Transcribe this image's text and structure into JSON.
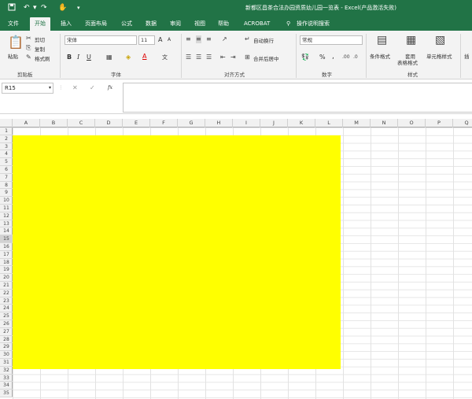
{
  "window": {
    "title": "新都区昌茶合法办园资质幼儿园一览表 - Excel(产品激活失败)",
    "qat": [
      "save-icon",
      "undo-icon",
      "redo-icon",
      "touch-mode-icon",
      "customize-icon"
    ]
  },
  "tabs": [
    {
      "label": "文件",
      "active": false
    },
    {
      "label": "开始",
      "active": true
    },
    {
      "label": "插入",
      "active": false
    },
    {
      "label": "页面布局",
      "active": false
    },
    {
      "label": "公式",
      "active": false
    },
    {
      "label": "数据",
      "active": false
    },
    {
      "label": "审阅",
      "active": false
    },
    {
      "label": "视图",
      "active": false
    },
    {
      "label": "帮助",
      "active": false
    },
    {
      "label": "ACROBAT",
      "active": false
    },
    {
      "label": "操作说明搜索",
      "active": false
    }
  ],
  "ribbon": {
    "clipboard": {
      "paste": "粘贴",
      "cut": "剪切",
      "copy": "复制",
      "format_painter": "格式刷",
      "group": "剪贴板"
    },
    "font": {
      "name": "宋体",
      "size": "11",
      "grow": "A",
      "shrink": "A",
      "bold": "B",
      "italic": "I",
      "underline": "U",
      "font_color_letter": "A",
      "wen": "文",
      "group": "字体"
    },
    "alignment": {
      "wrap_text": "自动换行",
      "merge_center": "合并后居中",
      "group": "对齐方式"
    },
    "number": {
      "format": "常规",
      "percent": "%",
      "comma": ",",
      "group": "数字"
    },
    "styles": {
      "conditional": "条件格式",
      "table_format_1": "套用",
      "table_format_2": "表格格式",
      "cell_styles": "单元格样式",
      "group": "样式"
    },
    "cells": {
      "insert_partial": "插"
    }
  },
  "formula_bar": {
    "name_box": "R15",
    "fx": "fx",
    "cancel": "✕",
    "enter": "✓",
    "content": ""
  },
  "columns": [
    "A",
    "B",
    "C",
    "D",
    "E",
    "F",
    "G",
    "H",
    "I",
    "J",
    "K",
    "L",
    "M",
    "N",
    "O",
    "P",
    "Q"
  ],
  "rows": [
    "1",
    "2",
    "3",
    "4",
    "5",
    "6",
    "7",
    "8",
    "9",
    "10",
    "11",
    "12",
    "13",
    "14",
    "15",
    "16",
    "17",
    "18",
    "19",
    "20",
    "21",
    "22",
    "23",
    "24",
    "25",
    "26",
    "27",
    "28",
    "29",
    "30",
    "31",
    "32",
    "33",
    "34",
    "35"
  ],
  "highlight": {
    "range": "A2:L31",
    "color": "#ffff00"
  }
}
